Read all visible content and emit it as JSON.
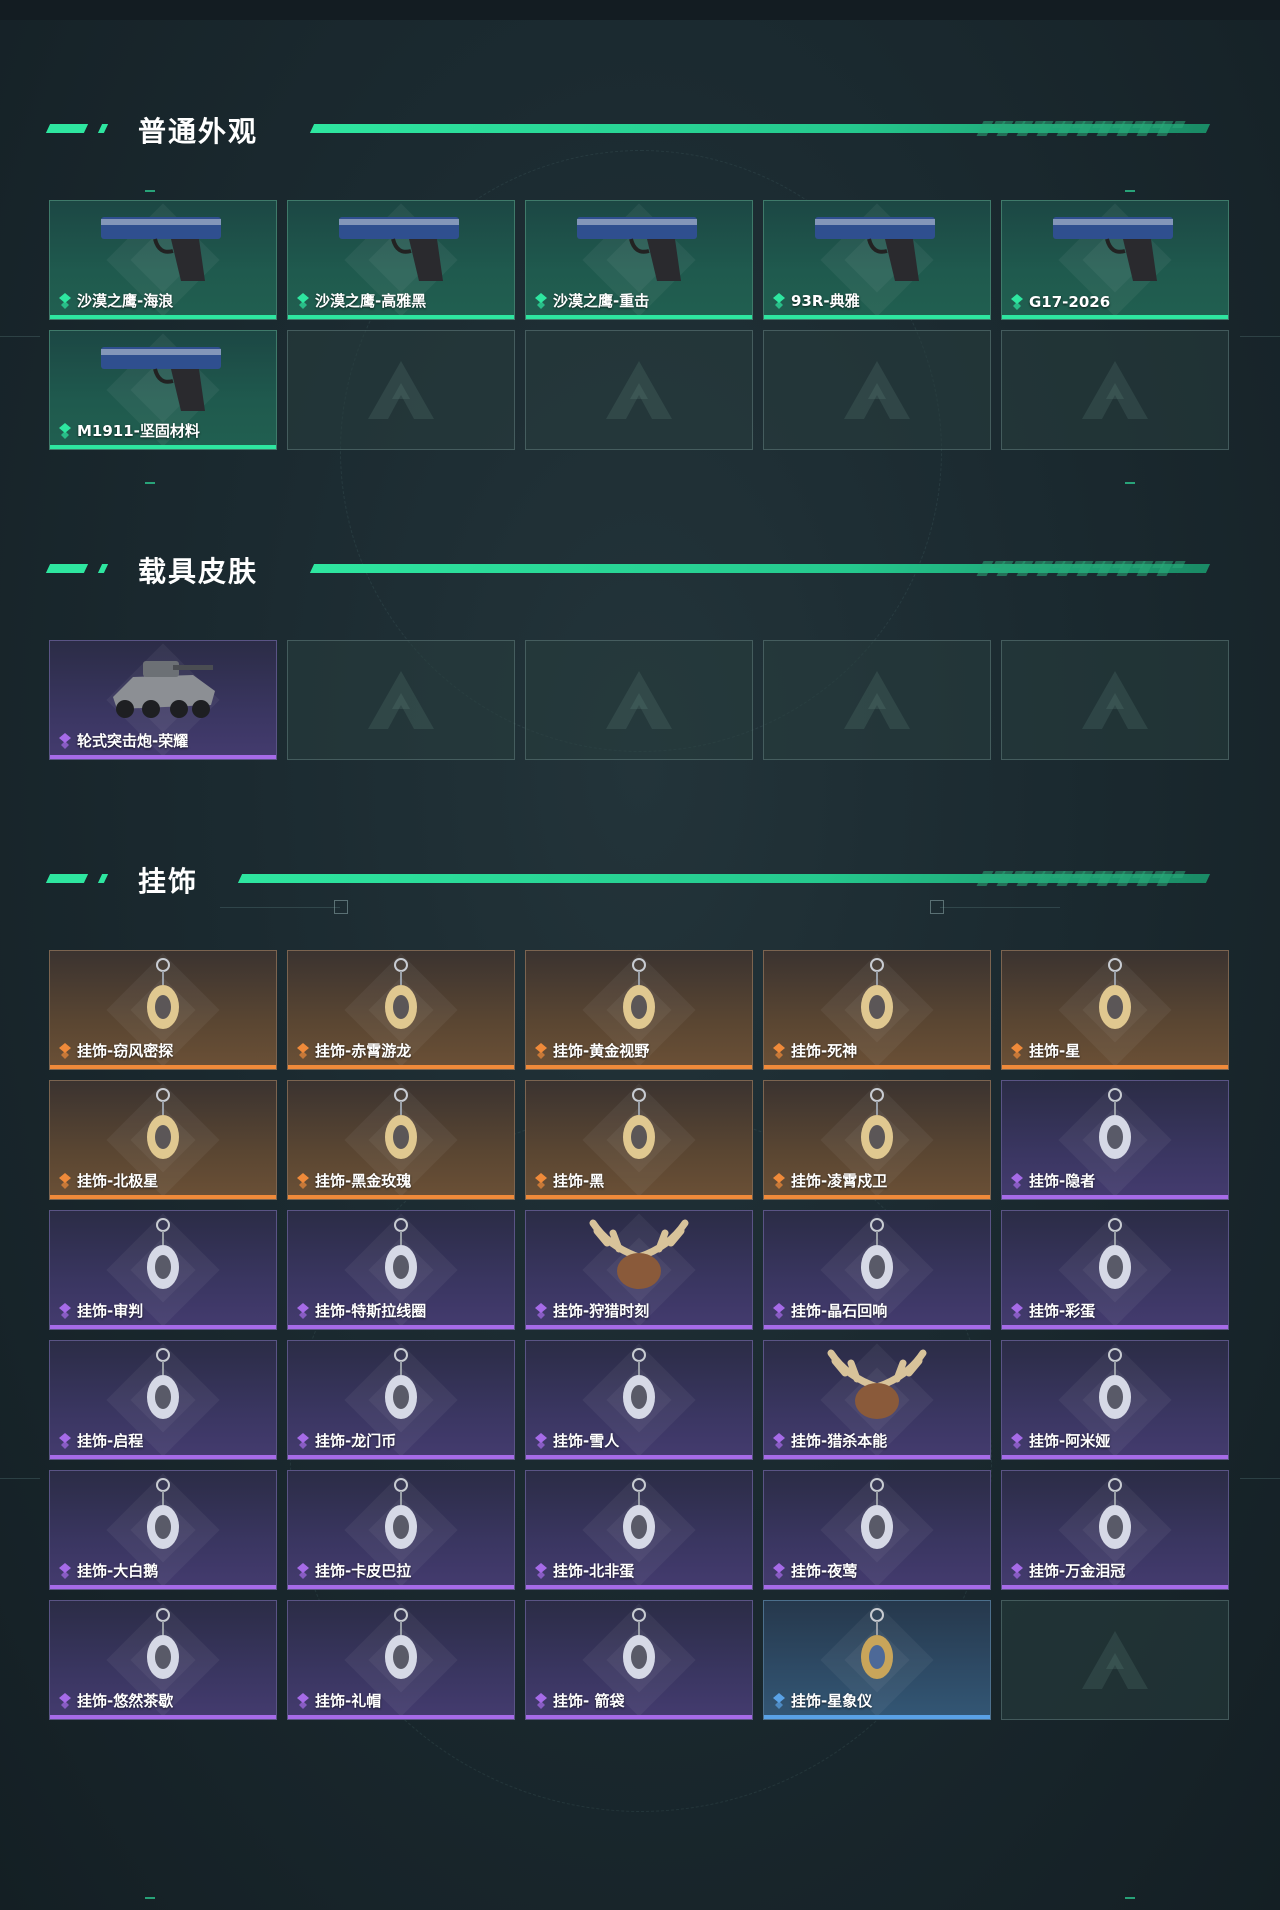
{
  "sections": [
    {
      "title": "普通外观",
      "rows": 2,
      "items": [
        {
          "label": "沙漠之鹰-海浪",
          "rarity": "green",
          "icon": "pistol-icon"
        },
        {
          "label": "沙漠之鹰-高雅黑",
          "rarity": "green",
          "icon": "pistol-icon"
        },
        {
          "label": "沙漠之鹰-重击",
          "rarity": "green",
          "icon": "pistol-icon"
        },
        {
          "label": "93R-典雅",
          "rarity": "green",
          "icon": "pistol-icon"
        },
        {
          "label": "G17-2026",
          "rarity": "green",
          "icon": "pistol-icon"
        },
        {
          "label": "M1911-坚固材料",
          "rarity": "green",
          "icon": "pistol-icon"
        }
      ]
    },
    {
      "title": "载具皮肤",
      "rows": 1,
      "items": [
        {
          "label": "轮式突击炮-荣耀",
          "rarity": "purple",
          "icon": "vehicle-icon"
        }
      ]
    },
    {
      "title": "挂饰",
      "rows": 6,
      "items": [
        {
          "label": "挂饰-窃风密探",
          "rarity": "orange",
          "icon": "charm-icon"
        },
        {
          "label": "挂饰-赤霄游龙",
          "rarity": "orange",
          "icon": "charm-icon"
        },
        {
          "label": "挂饰-黄金视野",
          "rarity": "orange",
          "icon": "charm-icon"
        },
        {
          "label": "挂饰-死神",
          "rarity": "orange",
          "icon": "charm-icon"
        },
        {
          "label": "挂饰-星",
          "rarity": "orange",
          "icon": "charm-icon"
        },
        {
          "label": "挂饰-北极星",
          "rarity": "orange",
          "icon": "charm-icon"
        },
        {
          "label": "挂饰-黑金玫瑰",
          "rarity": "orange",
          "icon": "charm-icon"
        },
        {
          "label": "挂饰-黑",
          "rarity": "orange",
          "icon": "charm-icon"
        },
        {
          "label": "挂饰-凌霄戍卫",
          "rarity": "orange",
          "icon": "charm-icon"
        },
        {
          "label": "挂饰-隐者",
          "rarity": "purple",
          "icon": "charm-icon"
        },
        {
          "label": "挂饰-审判",
          "rarity": "purple",
          "icon": "charm-icon"
        },
        {
          "label": "挂饰-特斯拉线圈",
          "rarity": "purple",
          "icon": "charm-icon"
        },
        {
          "label": "挂饰-狩猎时刻",
          "rarity": "purple",
          "icon": "antler-charm-icon"
        },
        {
          "label": "挂饰-晶石回响",
          "rarity": "purple",
          "icon": "charm-icon"
        },
        {
          "label": "挂饰-彩蛋",
          "rarity": "purple",
          "icon": "charm-icon"
        },
        {
          "label": "挂饰-启程",
          "rarity": "purple",
          "icon": "charm-icon"
        },
        {
          "label": "挂饰-龙门币",
          "rarity": "purple",
          "icon": "charm-icon"
        },
        {
          "label": "挂饰-雪人",
          "rarity": "purple",
          "icon": "charm-icon"
        },
        {
          "label": "挂饰-猎杀本能",
          "rarity": "purple",
          "icon": "antler-charm-icon"
        },
        {
          "label": "挂饰-阿米娅",
          "rarity": "purple",
          "icon": "charm-icon"
        },
        {
          "label": "挂饰-大白鹅",
          "rarity": "purple",
          "icon": "charm-icon"
        },
        {
          "label": "挂饰-卡皮巴拉",
          "rarity": "purple",
          "icon": "charm-icon"
        },
        {
          "label": "挂饰-北非蛋",
          "rarity": "purple",
          "icon": "charm-icon"
        },
        {
          "label": "挂饰-夜莺",
          "rarity": "purple",
          "icon": "charm-icon"
        },
        {
          "label": "挂饰-万金泪冠",
          "rarity": "purple",
          "icon": "charm-icon"
        },
        {
          "label": "挂饰-悠然茶歇",
          "rarity": "purple",
          "icon": "charm-icon"
        },
        {
          "label": "挂饰-礼帽",
          "rarity": "purple",
          "icon": "charm-icon"
        },
        {
          "label": "挂饰- 箭袋",
          "rarity": "purple",
          "icon": "charm-icon"
        },
        {
          "label": "挂饰-星象仪",
          "rarity": "blue",
          "icon": "charm-icon"
        }
      ]
    }
  ],
  "colors": {
    "accent": "#2ee6a0",
    "green": "#2ee6a0",
    "purple": "#a66be8",
    "orange": "#f08a3a",
    "blue": "#5aa2e6",
    "background": "#1b2a30"
  }
}
